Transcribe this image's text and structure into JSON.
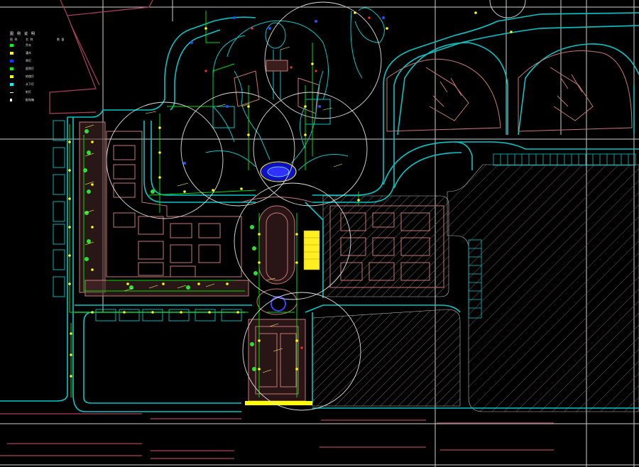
{
  "legend": {
    "title": "图 例 说 明",
    "headers": [
      "图 例",
      "名 称",
      "数 量"
    ],
    "rows": [
      {
        "label": "乔木",
        "color": "#00ff00"
      },
      {
        "label": "灌木",
        "color": "#ffff00"
      },
      {
        "label": "草灯",
        "color": "#0040ff"
      },
      {
        "label": "庭院灯",
        "color": "#00ff00"
      },
      {
        "label": "地埋灯",
        "color": "#ffff00"
      },
      {
        "label": "水下灯",
        "color": "#00ffff"
      },
      {
        "label": "射灯",
        "color": "#ffffff"
      },
      {
        "label": "配电箱",
        "color": "#ffffff"
      }
    ]
  },
  "colors": {
    "background": "#000000",
    "road": "#00c8c8",
    "building": "#c87878",
    "lighting": "#00ff00",
    "fixture": "#ffff00",
    "coverage_circle": "#dcdcdc",
    "water_feature": "#2020ff"
  }
}
